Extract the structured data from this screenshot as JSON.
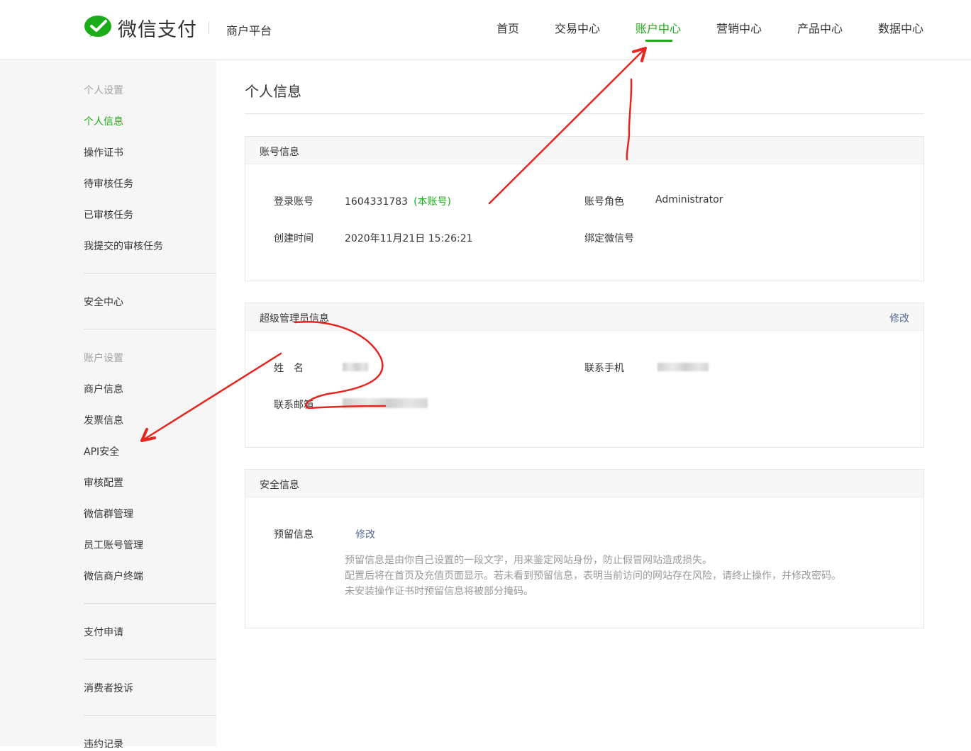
{
  "header": {
    "brand": "微信支付",
    "sub_brand": "商户平台",
    "nav": [
      "首页",
      "交易中心",
      "账户中心",
      "营销中心",
      "产品中心",
      "数据中心"
    ],
    "active_nav": "账户中心",
    "accent_color": "#1aad19"
  },
  "sidebar": {
    "group_personal": "个人设置",
    "personal_items": [
      "个人信息",
      "操作证书",
      "待审核任务",
      "已审核任务",
      "我提交的审核任务"
    ],
    "security_center": "安全中心",
    "group_account": "账户设置",
    "account_items": [
      "商户信息",
      "发票信息",
      "API安全",
      "审核配置",
      "微信群管理",
      "员工账号管理",
      "微信商户终端"
    ],
    "pay_apply": "支付申请",
    "complaints": "消费者投诉",
    "violations": "违约记录"
  },
  "main": {
    "title": "个人信息",
    "account_panel": {
      "title": "账号信息",
      "login_label": "登录账号",
      "login_value": "1604331783",
      "login_tag": "(本账号)",
      "role_label": "账号角色",
      "role_value": "Administrator",
      "created_label": "创建时间",
      "created_value": "2020年11月21日 15:26:21",
      "wechat_label": "绑定微信号"
    },
    "admin_panel": {
      "title": "超级管理员信息",
      "edit": "修改",
      "name_label": "姓　名",
      "phone_label": "联系手机",
      "email_label": "联系邮箱"
    },
    "security_panel": {
      "title": "安全信息",
      "reserved_label": "预留信息",
      "edit": "修改",
      "notes": [
        "预留信息是由你自己设置的一段文字，用来鉴定网站身份，防止假冒网站造成损失。",
        "配置后将在首页及充值页面显示。若未看到预留信息，表明当前访问的网站存在风险，请终止操作，并修改密码。",
        "未安装操作证书时预留信息将被部分掩码。"
      ]
    }
  },
  "annotation_color": "#e8241f"
}
